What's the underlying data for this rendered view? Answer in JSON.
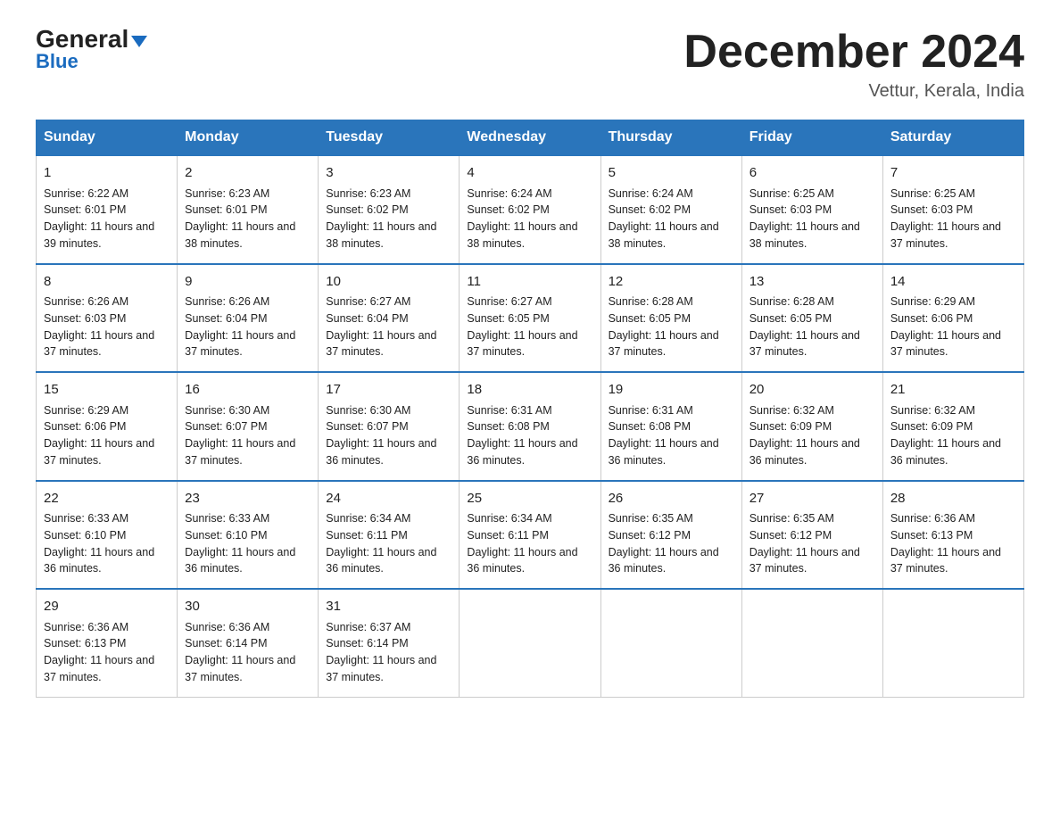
{
  "logo": {
    "text_general": "General",
    "text_blue": "Blue"
  },
  "title": "December 2024",
  "location": "Vettur, Kerala, India",
  "days_of_week": [
    "Sunday",
    "Monday",
    "Tuesday",
    "Wednesday",
    "Thursday",
    "Friday",
    "Saturday"
  ],
  "weeks": [
    [
      {
        "day": "1",
        "sunrise": "6:22 AM",
        "sunset": "6:01 PM",
        "daylight": "11 hours and 39 minutes."
      },
      {
        "day": "2",
        "sunrise": "6:23 AM",
        "sunset": "6:01 PM",
        "daylight": "11 hours and 38 minutes."
      },
      {
        "day": "3",
        "sunrise": "6:23 AM",
        "sunset": "6:02 PM",
        "daylight": "11 hours and 38 minutes."
      },
      {
        "day": "4",
        "sunrise": "6:24 AM",
        "sunset": "6:02 PM",
        "daylight": "11 hours and 38 minutes."
      },
      {
        "day": "5",
        "sunrise": "6:24 AM",
        "sunset": "6:02 PM",
        "daylight": "11 hours and 38 minutes."
      },
      {
        "day": "6",
        "sunrise": "6:25 AM",
        "sunset": "6:03 PM",
        "daylight": "11 hours and 38 minutes."
      },
      {
        "day": "7",
        "sunrise": "6:25 AM",
        "sunset": "6:03 PM",
        "daylight": "11 hours and 37 minutes."
      }
    ],
    [
      {
        "day": "8",
        "sunrise": "6:26 AM",
        "sunset": "6:03 PM",
        "daylight": "11 hours and 37 minutes."
      },
      {
        "day": "9",
        "sunrise": "6:26 AM",
        "sunset": "6:04 PM",
        "daylight": "11 hours and 37 minutes."
      },
      {
        "day": "10",
        "sunrise": "6:27 AM",
        "sunset": "6:04 PM",
        "daylight": "11 hours and 37 minutes."
      },
      {
        "day": "11",
        "sunrise": "6:27 AM",
        "sunset": "6:05 PM",
        "daylight": "11 hours and 37 minutes."
      },
      {
        "day": "12",
        "sunrise": "6:28 AM",
        "sunset": "6:05 PM",
        "daylight": "11 hours and 37 minutes."
      },
      {
        "day": "13",
        "sunrise": "6:28 AM",
        "sunset": "6:05 PM",
        "daylight": "11 hours and 37 minutes."
      },
      {
        "day": "14",
        "sunrise": "6:29 AM",
        "sunset": "6:06 PM",
        "daylight": "11 hours and 37 minutes."
      }
    ],
    [
      {
        "day": "15",
        "sunrise": "6:29 AM",
        "sunset": "6:06 PM",
        "daylight": "11 hours and 37 minutes."
      },
      {
        "day": "16",
        "sunrise": "6:30 AM",
        "sunset": "6:07 PM",
        "daylight": "11 hours and 37 minutes."
      },
      {
        "day": "17",
        "sunrise": "6:30 AM",
        "sunset": "6:07 PM",
        "daylight": "11 hours and 36 minutes."
      },
      {
        "day": "18",
        "sunrise": "6:31 AM",
        "sunset": "6:08 PM",
        "daylight": "11 hours and 36 minutes."
      },
      {
        "day": "19",
        "sunrise": "6:31 AM",
        "sunset": "6:08 PM",
        "daylight": "11 hours and 36 minutes."
      },
      {
        "day": "20",
        "sunrise": "6:32 AM",
        "sunset": "6:09 PM",
        "daylight": "11 hours and 36 minutes."
      },
      {
        "day": "21",
        "sunrise": "6:32 AM",
        "sunset": "6:09 PM",
        "daylight": "11 hours and 36 minutes."
      }
    ],
    [
      {
        "day": "22",
        "sunrise": "6:33 AM",
        "sunset": "6:10 PM",
        "daylight": "11 hours and 36 minutes."
      },
      {
        "day": "23",
        "sunrise": "6:33 AM",
        "sunset": "6:10 PM",
        "daylight": "11 hours and 36 minutes."
      },
      {
        "day": "24",
        "sunrise": "6:34 AM",
        "sunset": "6:11 PM",
        "daylight": "11 hours and 36 minutes."
      },
      {
        "day": "25",
        "sunrise": "6:34 AM",
        "sunset": "6:11 PM",
        "daylight": "11 hours and 36 minutes."
      },
      {
        "day": "26",
        "sunrise": "6:35 AM",
        "sunset": "6:12 PM",
        "daylight": "11 hours and 36 minutes."
      },
      {
        "day": "27",
        "sunrise": "6:35 AM",
        "sunset": "6:12 PM",
        "daylight": "11 hours and 37 minutes."
      },
      {
        "day": "28",
        "sunrise": "6:36 AM",
        "sunset": "6:13 PM",
        "daylight": "11 hours and 37 minutes."
      }
    ],
    [
      {
        "day": "29",
        "sunrise": "6:36 AM",
        "sunset": "6:13 PM",
        "daylight": "11 hours and 37 minutes."
      },
      {
        "day": "30",
        "sunrise": "6:36 AM",
        "sunset": "6:14 PM",
        "daylight": "11 hours and 37 minutes."
      },
      {
        "day": "31",
        "sunrise": "6:37 AM",
        "sunset": "6:14 PM",
        "daylight": "11 hours and 37 minutes."
      },
      null,
      null,
      null,
      null
    ]
  ]
}
